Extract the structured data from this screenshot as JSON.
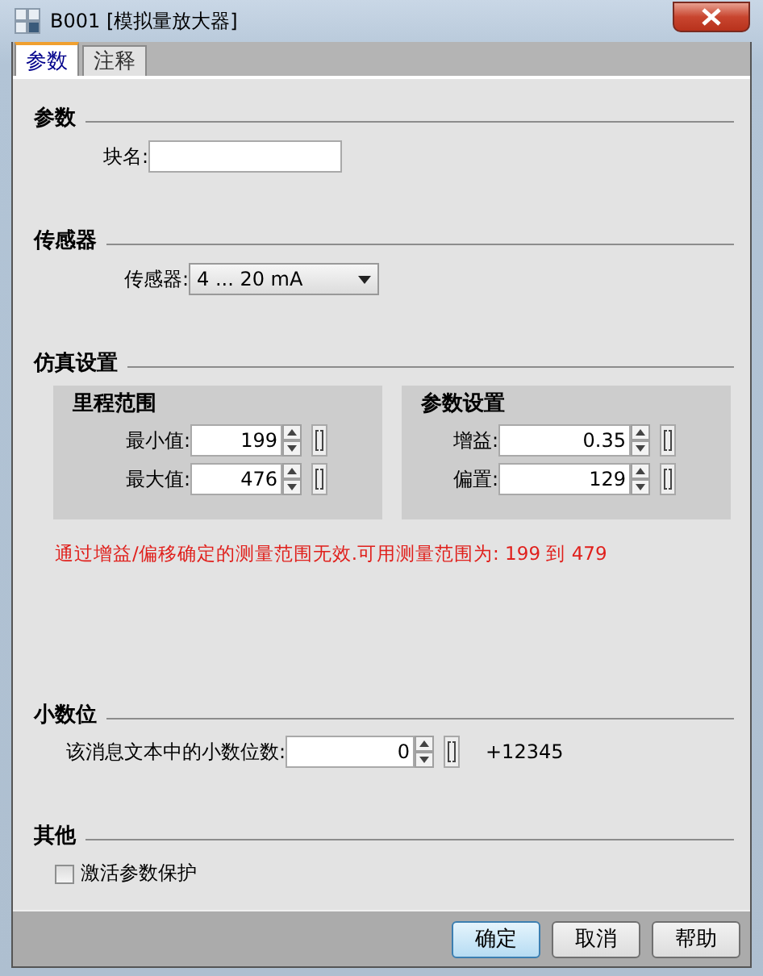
{
  "window": {
    "title": "B001 [模拟量放大器]"
  },
  "tabs": [
    {
      "label": "参数",
      "selected": true
    },
    {
      "label": "注释",
      "selected": false
    }
  ],
  "parameters": {
    "heading": "参数",
    "block_name": {
      "label": "块名:"
    }
  },
  "sensor": {
    "heading": "传感器",
    "label": "传感器:",
    "value": "4 ... 20 mA"
  },
  "simulation": {
    "heading": "仿真设置",
    "groups": [
      {
        "title": "里程范围",
        "fields": [
          {
            "label": "最小值:",
            "value": "199"
          },
          {
            "label": "最大值:",
            "value": "476"
          }
        ]
      },
      {
        "title": "参数设置",
        "fields": [
          {
            "label": "增益:",
            "value": "0.35"
          },
          {
            "label": "偏置:",
            "value": "129"
          }
        ]
      }
    ],
    "message": "通过增益/偏移确定的测量范围无效.可用测量范围为: 199 到 479"
  },
  "decimals": {
    "heading": "小数位",
    "label": "该消息文本中的小数位数:",
    "value": "0",
    "preview": "+12345"
  },
  "other": {
    "heading": "其他",
    "checkbox": {
      "label": "激活参数保护",
      "checked": false
    }
  },
  "buttons": [
    {
      "label": "确定",
      "default": true
    },
    {
      "label": "取消",
      "default": false
    },
    {
      "label": "帮助",
      "default": false
    }
  ]
}
